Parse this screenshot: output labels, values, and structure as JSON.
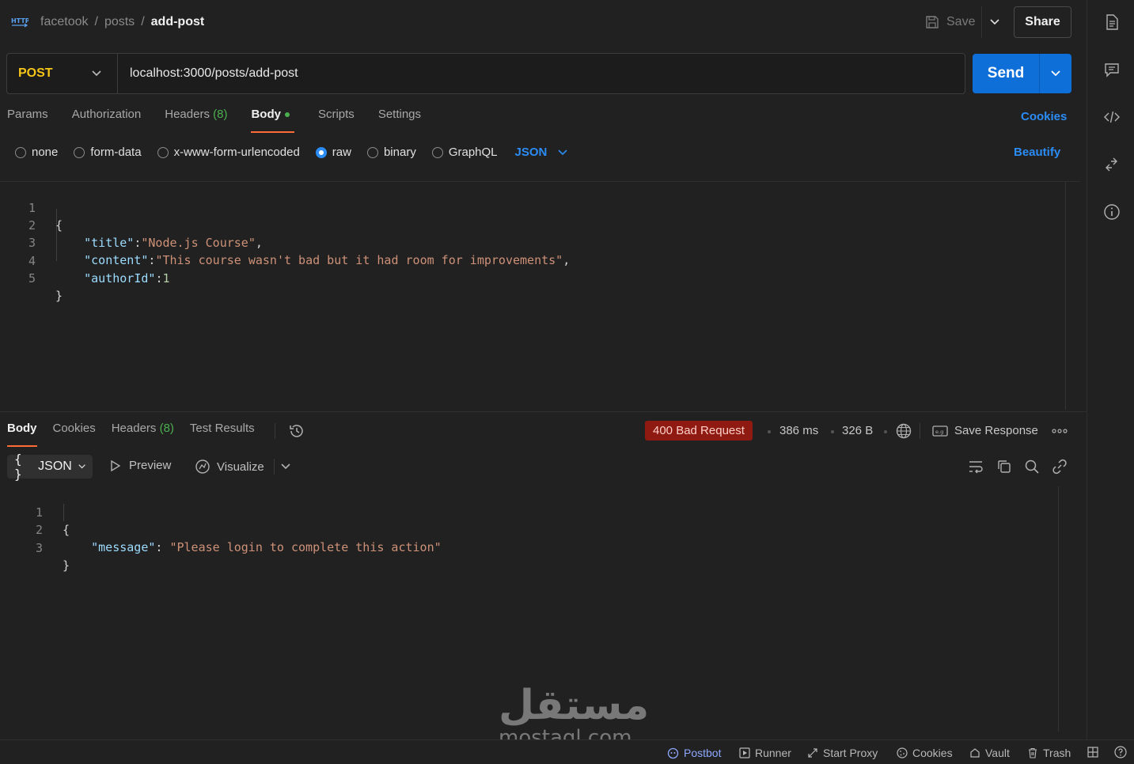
{
  "header": {
    "breadcrumb": [
      "facetook",
      "posts",
      "add-post"
    ],
    "save_label": "Save",
    "share_label": "Share"
  },
  "request": {
    "method": "POST",
    "url": "localhost:3000/posts/add-post",
    "send_label": "Send",
    "tabs": [
      {
        "label": "Params"
      },
      {
        "label": "Authorization"
      },
      {
        "label": "Headers",
        "count": "(8)"
      },
      {
        "label": "Body"
      },
      {
        "label": "Scripts"
      },
      {
        "label": "Settings"
      }
    ],
    "cookies_label": "Cookies",
    "body_types": [
      "none",
      "form-data",
      "x-www-form-urlencoded",
      "raw",
      "binary",
      "GraphQL"
    ],
    "body_selected": "raw",
    "language": "JSON",
    "beautify_label": "Beautify",
    "code_lines": [
      {
        "n": "1"
      },
      {
        "n": "2",
        "key": "\"title\"",
        "value": "\"Node.js Course\""
      },
      {
        "n": "3",
        "key": "\"content\"",
        "value": "\"This course wasn't bad but it had room for improvements\""
      },
      {
        "n": "4",
        "key": "\"authorId\"",
        "value": "1"
      },
      {
        "n": "5"
      }
    ]
  },
  "response": {
    "tabs": [
      {
        "label": "Body"
      },
      {
        "label": "Cookies"
      },
      {
        "label": "Headers",
        "count": "(8)"
      },
      {
        "label": "Test Results"
      }
    ],
    "status": "400 Bad Request",
    "time": "386 ms",
    "size": "326 B",
    "save_response_label": "Save Response",
    "format": "JSON",
    "preview_label": "Preview",
    "visualize_label": "Visualize",
    "code_lines": [
      {
        "n": "1"
      },
      {
        "n": "2",
        "key": "\"message\"",
        "value": "\"Please login to complete this action\""
      },
      {
        "n": "3"
      }
    ]
  },
  "statusbar": {
    "postbot": "Postbot",
    "runner": "Runner",
    "start_proxy": "Start Proxy",
    "cookies": "Cookies",
    "vault": "Vault",
    "trash": "Trash"
  },
  "watermark": {
    "arabic": "مستقل",
    "latin": "mostaql.com"
  },
  "colors": {
    "accent": "#ff6c37",
    "link": "#2b8cf5",
    "send": "#0e6fd9",
    "method": "#f5c518",
    "error_badge": "#8e1a11",
    "success_dot": "#4caf50"
  }
}
